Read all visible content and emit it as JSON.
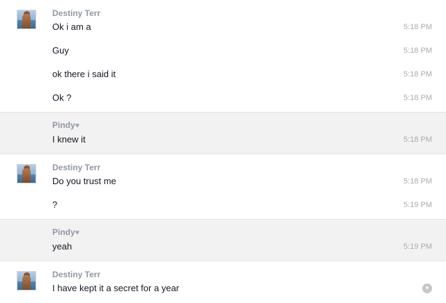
{
  "groups": [
    {
      "sender": "Destiny Terr",
      "heart": "",
      "messages": [
        {
          "text": "Ok i am a",
          "time": "5:18 PM"
        },
        {
          "text": "Guy",
          "time": "5:18 PM"
        },
        {
          "text": "ok there i said it",
          "time": "5:18 PM"
        },
        {
          "text": "Ok ?",
          "time": "5:18 PM"
        }
      ]
    },
    {
      "sender": "Pindy",
      "heart": "♥",
      "messages": [
        {
          "text": "I knew it",
          "time": "5:18 PM"
        }
      ]
    },
    {
      "sender": "Destiny Terr",
      "heart": "",
      "messages": [
        {
          "text": "Do you trust me",
          "time": "5:18 PM"
        },
        {
          "text": "?",
          "time": "5:19 PM"
        }
      ]
    },
    {
      "sender": "Pindy",
      "heart": "♥",
      "messages": [
        {
          "text": "yeah",
          "time": "5:19 PM"
        }
      ]
    },
    {
      "sender": "Destiny Terr",
      "heart": "",
      "messages": [
        {
          "text": "I have kept it a secret for a year",
          "time": ""
        }
      ],
      "options_icon": "chevron-down-icon"
    }
  ]
}
